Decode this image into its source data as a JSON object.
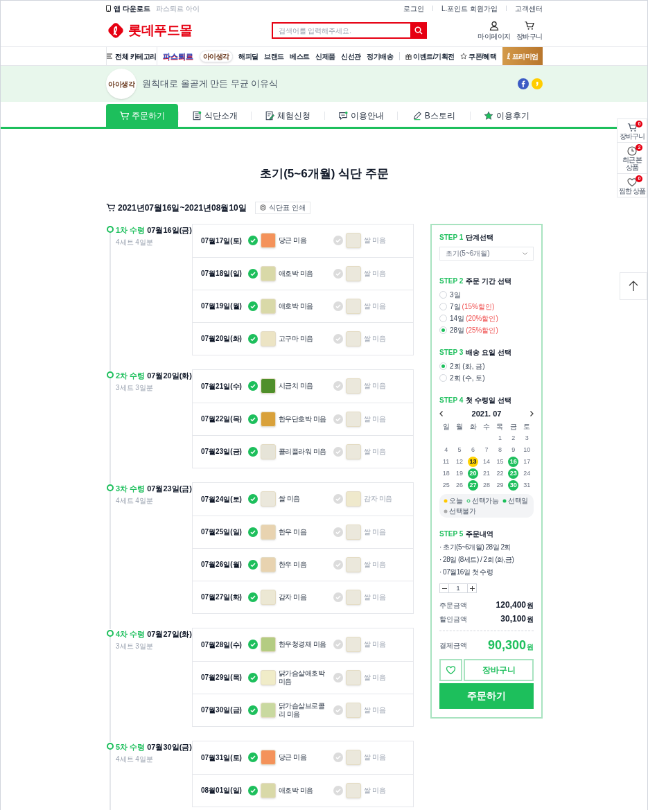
{
  "top_bar": {
    "app_download": "앱 다운로드",
    "brand_link": "파스퇴르 아이",
    "links": [
      "로그인",
      "L.포인트 회원가입",
      "고객센터"
    ]
  },
  "header": {
    "logo_text": "롯데푸드몰",
    "search": {
      "placeholder": "검색어를 입력해주세요."
    },
    "actions": [
      {
        "kind": "mypage",
        "label": "마이페이지"
      },
      {
        "kind": "cart",
        "label": "장바구니"
      }
    ]
  },
  "nav": {
    "category_button": "전체 카테고리",
    "brands": [
      {
        "kind": "wordmark",
        "label": "파스퇴르"
      },
      {
        "kind": "badge",
        "label": "아이생각"
      }
    ],
    "items": [
      "해피딜",
      "브랜드",
      "베스트",
      "신제품",
      "신선관",
      "정기배송"
    ],
    "promos": [
      {
        "kind": "gift",
        "label": "이벤트/기획전"
      },
      {
        "kind": "coupon",
        "label": "쿠폰/혜택"
      }
    ],
    "premium": "프리미엄"
  },
  "banner": {
    "logo_label": "아이생각",
    "tagline": "원칙대로 올곧게 만든 무균 이유식",
    "social": [
      {
        "kind": "facebook"
      },
      {
        "kind": "kakaostory"
      }
    ]
  },
  "tabs": [
    {
      "kind": "cart",
      "label": "주문하기",
      "selected": true
    },
    {
      "kind": "list",
      "label": "식단소개",
      "selected": false
    },
    {
      "kind": "form",
      "label": "체험신청",
      "selected": false
    },
    {
      "kind": "chat",
      "label": "이용안내",
      "selected": false
    },
    {
      "kind": "pen",
      "label": "B스토리",
      "selected": false
    },
    {
      "kind": "star",
      "label": "이용후기",
      "selected": false
    }
  ],
  "quick_menu": [
    {
      "kind": "cart",
      "label": "장바구니",
      "count": "0"
    },
    {
      "kind": "recent",
      "label": "최근 본 상품",
      "count": "2"
    },
    {
      "kind": "wish",
      "label": "찜한 상품",
      "count": "0"
    }
  ],
  "page_title": "초기(5~6개월) 식단 주문",
  "period": {
    "text": "2021년07월16일~2021년08월10일",
    "print_button": "식단표 인쇄"
  },
  "deliveries": [
    {
      "round": "1차 수령",
      "date": "07월16일(금)",
      "sets": "4세트 4일분",
      "days": [
        {
          "date": "07월17일(토)",
          "meals": [
            {
              "name": "당근 미음",
              "checked": true,
              "color": "#f4925a"
            },
            {
              "name": "쌀 미음",
              "checked": false,
              "color": "#ebe8dc"
            }
          ]
        },
        {
          "date": "07월18일(일)",
          "meals": [
            {
              "name": "애호박 미음",
              "checked": true,
              "color": "#d9d9a8"
            },
            {
              "name": "쌀 미음",
              "checked": false,
              "color": "#ebe8dc"
            }
          ]
        },
        {
          "date": "07월19일(월)",
          "meals": [
            {
              "name": "애호박 미음",
              "checked": true,
              "color": "#d9d9a8"
            },
            {
              "name": "쌀 미음",
              "checked": false,
              "color": "#ebe8dc"
            }
          ]
        },
        {
          "date": "07월20일(화)",
          "meals": [
            {
              "name": "고구마 미음",
              "checked": true,
              "color": "#ece4c4"
            },
            {
              "name": "쌀 미음",
              "checked": false,
              "color": "#ebe8dc"
            }
          ]
        }
      ]
    },
    {
      "round": "2차 수령",
      "date": "07월20일(화)",
      "sets": "3세트 3일분",
      "days": [
        {
          "date": "07월21일(수)",
          "meals": [
            {
              "name": "시금치 미음",
              "checked": true,
              "color": "#4f8f2a"
            },
            {
              "name": "쌀 미음",
              "checked": false,
              "color": "#ebe8dc"
            }
          ]
        },
        {
          "date": "07월22일(목)",
          "meals": [
            {
              "name": "한우단호박 미음",
              "checked": true,
              "color": "#d9a13a"
            },
            {
              "name": "쌀 미음",
              "checked": false,
              "color": "#ebe8dc"
            }
          ]
        },
        {
          "date": "07월23일(금)",
          "meals": [
            {
              "name": "콜리플라워 미음",
              "checked": true,
              "color": "#e6e4d8"
            },
            {
              "name": "쌀 미음",
              "checked": false,
              "color": "#ebe8dc"
            }
          ]
        }
      ]
    },
    {
      "round": "3차 수령",
      "date": "07월23일(금)",
      "sets": "4세트 4일분",
      "days": [
        {
          "date": "07월24일(토)",
          "meals": [
            {
              "name": "쌀 미음",
              "checked": true,
              "color": "#ebe8dc"
            },
            {
              "name": "감자 미음",
              "checked": false,
              "color": "#efe9cc"
            }
          ]
        },
        {
          "date": "07월25일(일)",
          "meals": [
            {
              "name": "한우 미음",
              "checked": true,
              "color": "#e8d3b0"
            },
            {
              "name": "쌀 미음",
              "checked": false,
              "color": "#ebe8dc"
            }
          ]
        },
        {
          "date": "07월26일(월)",
          "meals": [
            {
              "name": "한우 미음",
              "checked": true,
              "color": "#e8d3b0"
            },
            {
              "name": "쌀 미음",
              "checked": false,
              "color": "#ebe8dc"
            }
          ]
        },
        {
          "date": "07월27일(화)",
          "meals": [
            {
              "name": "감자 미음",
              "checked": true,
              "color": "#ece8d4"
            },
            {
              "name": "쌀 미음",
              "checked": false,
              "color": "#ebe8dc"
            }
          ]
        }
      ]
    },
    {
      "round": "4차 수령",
      "date": "07월27일(화)",
      "sets": "3세트 3일분",
      "days": [
        {
          "date": "07월28일(수)",
          "meals": [
            {
              "name": "한우청경채 미음",
              "checked": true,
              "color": "#b4cc82"
            },
            {
              "name": "쌀 미음",
              "checked": false,
              "color": "#ebe8dc"
            }
          ]
        },
        {
          "date": "07월29일(목)",
          "meals": [
            {
              "name": "닭가슴살애호박 미음",
              "checked": true,
              "color": "#f0ecc8"
            },
            {
              "name": "쌀 미음",
              "checked": false,
              "color": "#ebe8dc"
            }
          ]
        },
        {
          "date": "07월30일(금)",
          "meals": [
            {
              "name": "닭가슴살브로콜리 미음",
              "checked": true,
              "color": "#c9d9a0"
            },
            {
              "name": "쌀 미음",
              "checked": false,
              "color": "#ebe8dc"
            }
          ]
        }
      ]
    },
    {
      "round": "5차 수령",
      "date": "07월30일(금)",
      "sets": "4세트 4일분",
      "days": [
        {
          "date": "07월31일(토)",
          "meals": [
            {
              "name": "당근 미음",
              "checked": true,
              "color": "#f4925a"
            },
            {
              "name": "쌀 미음",
              "checked": false,
              "color": "#ebe8dc"
            }
          ]
        },
        {
          "date": "08월01일(일)",
          "meals": [
            {
              "name": "애호박 미음",
              "checked": true,
              "color": "#d9d9a8"
            },
            {
              "name": "쌀 미음",
              "checked": false,
              "color": "#ebe8dc"
            }
          ]
        }
      ]
    }
  ],
  "order_panel": {
    "step1": {
      "step": "STEP 1",
      "title": "단계선택",
      "select_value": "초기(5~6개월)"
    },
    "step2": {
      "step": "STEP 2",
      "title": "주문 기간 선택",
      "options": [
        {
          "label": "3일",
          "selected": false
        },
        {
          "label": "7일",
          "note": "(15%할인)",
          "selected": false
        },
        {
          "label": "14일",
          "note": "(20%할인)",
          "selected": false
        },
        {
          "label": "28일",
          "note": "(25%할인)",
          "selected": true
        }
      ]
    },
    "step3": {
      "step": "STEP 3",
      "title": "배송 요일 선택",
      "options": [
        {
          "label": "2회 (화, 금)",
          "selected": true
        },
        {
          "label": "2회 (수, 토)",
          "selected": false
        }
      ]
    },
    "step4": {
      "step": "STEP 4",
      "title": "첫 수령일 선택",
      "month": "2021. 07",
      "weekdays": [
        "일",
        "월",
        "화",
        "수",
        "목",
        "금",
        "토"
      ],
      "weeks": [
        [
          {
            "day": "1",
            "kind": "unavailable"
          },
          {
            "day": "2",
            "kind": "unavailable"
          },
          {
            "day": "3",
            "kind": "unavailable"
          }
        ],
        [
          {
            "day": "4",
            "kind": "unavailable"
          },
          {
            "day": "5",
            "kind": "unavailable"
          },
          {
            "day": "6",
            "kind": "unavailable"
          },
          {
            "day": "7",
            "kind": "unavailable"
          },
          {
            "day": "8",
            "kind": "unavailable"
          },
          {
            "day": "9",
            "kind": "unavailable"
          },
          {
            "day": "10",
            "kind": "unavailable"
          }
        ],
        [
          {
            "day": "11",
            "kind": "unavailable"
          },
          {
            "day": "12",
            "kind": "unavailable"
          },
          {
            "day": "13",
            "kind": "today"
          },
          {
            "day": "14",
            "kind": "unavailable"
          },
          {
            "day": "15",
            "kind": "unavailable"
          },
          {
            "day": "16",
            "kind": "selected"
          },
          {
            "day": "17",
            "kind": "unavailable"
          }
        ],
        [
          {
            "day": "18",
            "kind": "unavailable"
          },
          {
            "day": "19",
            "kind": "unavailable"
          },
          {
            "day": "20",
            "kind": "selected"
          },
          {
            "day": "21",
            "kind": "unavailable"
          },
          {
            "day": "22",
            "kind": "unavailable"
          },
          {
            "day": "23",
            "kind": "selected"
          },
          {
            "day": "24",
            "kind": "unavailable"
          }
        ],
        [
          {
            "day": "25",
            "kind": "unavailable"
          },
          {
            "day": "26",
            "kind": "unavailable"
          },
          {
            "day": "27",
            "kind": "selected"
          },
          {
            "day": "28",
            "kind": "unavailable"
          },
          {
            "day": "29",
            "kind": "unavailable"
          },
          {
            "day": "30",
            "kind": "selected"
          },
          {
            "day": "31",
            "kind": "unavailable"
          }
        ]
      ],
      "legend": [
        {
          "kind": "today",
          "label": "오늘"
        },
        {
          "kind": "available",
          "label": "선택가능"
        },
        {
          "kind": "selected",
          "label": "선택일"
        },
        {
          "kind": "unavailable",
          "label": "선택불가"
        }
      ]
    },
    "step5": {
      "step": "STEP 5",
      "title": "주문내역",
      "lines": [
        "· 초기(5~6개월) 28일 2회",
        "· 28일 (8세트) / 2회 (화,금)",
        "· 07월16일 첫 수령"
      ],
      "quantity": "1",
      "totals": [
        {
          "kind": "order",
          "label": "주문금액",
          "amount": "120,400",
          "unit": "원"
        },
        {
          "kind": "discount",
          "label": "할인금액",
          "amount": "30,100",
          "unit": "원"
        },
        {
          "kind": "payment",
          "label": "결제금액",
          "amount": "90,300",
          "unit": "원"
        }
      ]
    },
    "cart_button": "장바구니",
    "order_button": "주문하기"
  }
}
